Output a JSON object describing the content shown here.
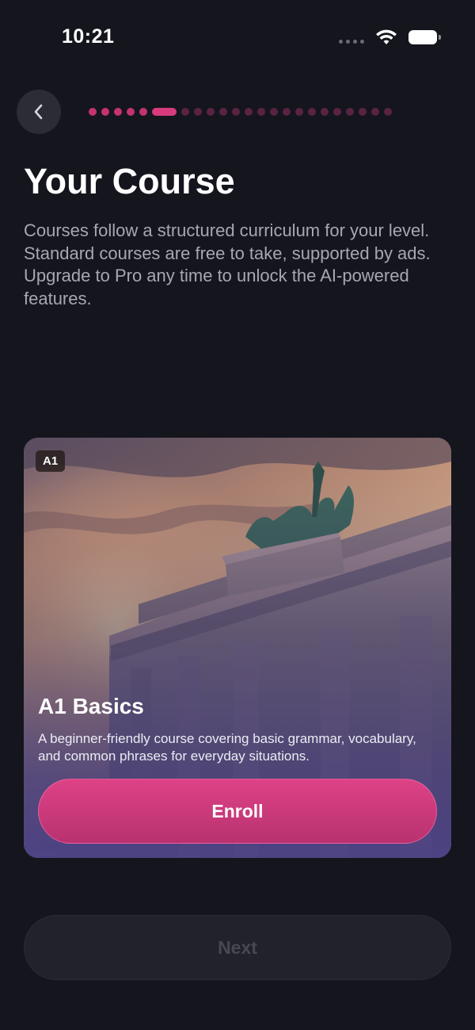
{
  "status_bar": {
    "time": "10:21"
  },
  "header": {
    "back_icon": "chevron-left-icon",
    "progress": {
      "total_steps": 23,
      "current_step": 6,
      "completed_color": "#c4336f",
      "active_color": "#d83b7d",
      "upcoming_color": "#5a2341"
    }
  },
  "page": {
    "title": "Your Course",
    "description": "Courses follow a structured curriculum for your level. Standard courses are free to take, supported by ads. Upgrade to Pro any time to unlock the AI-powered features."
  },
  "course_card": {
    "level_badge": "A1",
    "title": "A1 Basics",
    "description": "A beginner-friendly course covering basic grammar, vocabulary, and common phrases for everyday situations.",
    "enroll_label": "Enroll",
    "accent_color": "#d03c7e"
  },
  "footer": {
    "next_label": "Next"
  },
  "colors": {
    "background": "#15151e",
    "accent": "#d83b7d"
  }
}
